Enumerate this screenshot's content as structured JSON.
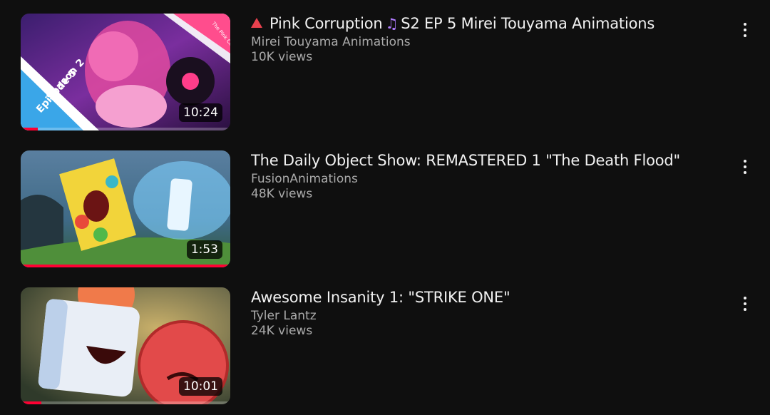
{
  "videos": [
    {
      "title": "Pink Corruption",
      "title_suffix": "S2 EP 5 Mirei Touyama Animations",
      "title_prefix_icon": "red-triangle-icon",
      "title_mid_icon": "music-note-icon",
      "channel": "Mirei Touyama Animations",
      "views": "10K views",
      "duration": "10:24",
      "watch_progress": 0.08,
      "thumb_text": [
        "Season 2",
        "Episode 5",
        "The Pink Corruption"
      ]
    },
    {
      "title": "The Daily Object Show: REMASTERED 1 \"The Death Flood\"",
      "channel": "FusionAnimations",
      "views": "48K views",
      "duration": "1:53",
      "watch_progress": 1.0
    },
    {
      "title": "Awesome Insanity 1: \"STRIKE ONE\"",
      "channel": "Tyler Lantz",
      "views": "24K views",
      "duration": "10:01",
      "watch_progress": 0.1
    }
  ],
  "colors": {
    "background": "#0f0f0f",
    "title": "#f1f1f1",
    "secondary_text": "#aaaaaa",
    "progress": "#ff0033"
  },
  "icons": {
    "more": "vertical-ellipsis-icon"
  }
}
